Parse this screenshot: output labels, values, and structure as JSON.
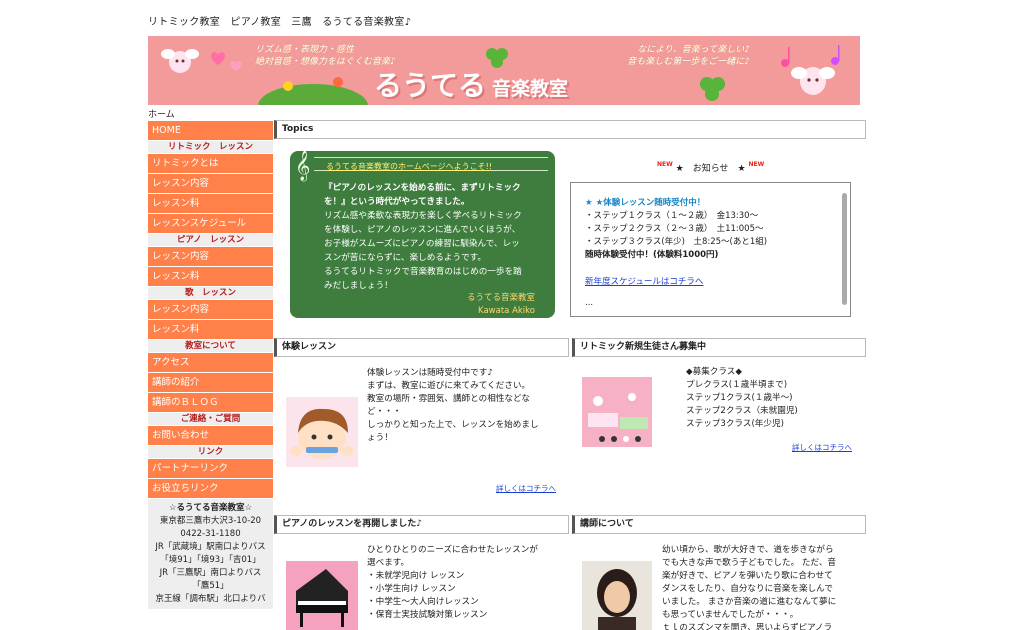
{
  "site_title": "リトミック教室　ピアノ教室　三鷹　るうてる音楽教室♪",
  "banner": {
    "tagline_left_1": "リズム感・表現力・感性",
    "tagline_left_2": "絶対音感・想像力をはぐくむ音楽♪",
    "logo_main": "るうてる",
    "logo_sub": "音楽教室",
    "tagline_right_1": "なにより、音楽って楽しい♪",
    "tagline_right_2": "音も楽しむ第一歩をご一緒に♪"
  },
  "breadcrumb": "ホーム",
  "sidebar": {
    "home": "HOME",
    "rhythmic_head": "リトミック　レッスン",
    "rhythmic_items": [
      "リトミックとは",
      "レッスン内容",
      "レッスン料",
      "レッスンスケジュール"
    ],
    "piano_head": "ピアノ　レッスン",
    "piano_items": [
      "レッスン内容",
      "レッスン料"
    ],
    "song_head": "歌　レッスン",
    "song_items": [
      "レッスン内容",
      "レッスン料"
    ],
    "about_head": "教室について",
    "about_items": [
      "アクセス",
      "講師の紹介",
      "講師のＢＬＯＧ"
    ],
    "contact_head": "ご連絡・ご質問",
    "contact_items": [
      "お問い合わせ"
    ],
    "link_head": "リンク",
    "link_items": [
      "パートナーリンク",
      "お役立ちリンク"
    ],
    "address": {
      "name": "☆るうてる音楽教室☆",
      "line1": "東京都三鷹市大沢3-10-20",
      "line2": "0422-31-1180",
      "line3": "JR「武蔵境」駅南口よりバス",
      "line4": "「境91」「境93」「吉01」",
      "line5": "JR「三鷹駅」南口よりバス",
      "line6": "「鷹51」",
      "line7": "京王線「調布駅」北口よりバ"
    }
  },
  "topics": {
    "header": "Topics",
    "welcome_title": "るうてる音楽教室のホームページへようこそ!!",
    "welcome_lead_1": "『ピアノのレッスンを始める前に、まずリトミック",
    "welcome_lead_2": "を！』という時代がやってきました。",
    "welcome_lines": [
      "リズム感や柔軟な表現力を楽しく学べるリトミック",
      "を体験し、ピアノのレッスンに進んでいくほうが、",
      "お子様がスムーズにピアノの練習に馴染んで、レッ",
      "スンが苦にならずに、楽しめるようです。",
      "るうてるリトミックで音楽教育のはじめの一歩を踏",
      "みだしましょう！"
    ],
    "welcome_sign_1": "るうてる音楽教室",
    "welcome_sign_2": "Kawata Akiko"
  },
  "news": {
    "new_badge": "NEW",
    "heading": "★　お知らせ　★",
    "title": "★ ★体験レッスン随時受付中！",
    "lines": [
      "・ステップ１クラス（１～２歳）　金13:30～",
      "・ステップ２クラス（２～３歳）　土11:005～",
      "・ステップ３クラス(年少)　土8:25～(あと1組)"
    ],
    "fee": "随時体験受付中！(体験料1000円)",
    "link": "新年度スケジュールはコチラへ",
    "ellipsis": "..."
  },
  "sections": {
    "trial": {
      "header": "体験レッスン",
      "lines": [
        "体験レッスンは随時受付中です♪",
        "まずは、教室に遊びに来てみてください。",
        "教室の場所・雰囲気、講師との相性などな",
        "ど・・・",
        "しっかりと知った上で、レッスンを始めまし",
        "ょう！"
      ],
      "more": "詳しくはコチラへ"
    },
    "rhythmic_new": {
      "header": "リトミック新規生徒さん募集中",
      "lines": [
        "◆募集クラス◆",
        "プレクラス(１歳半頃まで)",
        "ステップ1クラス(１歳半～)",
        "ステップ2クラス（未就園児)",
        "ステップ3クラス(年少児)"
      ],
      "more": "詳しくはコチラへ"
    },
    "piano_restart": {
      "header": "ピアノのレッスンを再開しました♪",
      "lines": [
        "ひとりひとりのニーズに合わせたレッスンが",
        "選べます。",
        "・未就学児向け レッスン",
        "・小学生向け レッスン",
        "・中学生～大人向けレッスン",
        "・保育士実技試験対策レッスン"
      ]
    },
    "teacher": {
      "header": "講師について",
      "lines": [
        "幼い頃から、歌が大好きで、道を歩きながら",
        "でも大きな声で歌う子どもでした。 ただ、音",
        "楽が好きで、ピアノを弾いたり歌に合わせて",
        "ダンスをしたり、自分なりに音楽を楽しんで",
        "いました。 まさか音楽の道に進むなんて夢に",
        "も思っていませんでしたが・・・。",
        "ｔｌのスズンマを開き、思いよらずピアノラ"
      ]
    }
  },
  "colors": {
    "nav": "#ff8049",
    "banner": "#f39a9a",
    "welcome_bg": "#3f7d3f",
    "accent_red": "#b51b1b",
    "link": "#1b3fd0"
  }
}
